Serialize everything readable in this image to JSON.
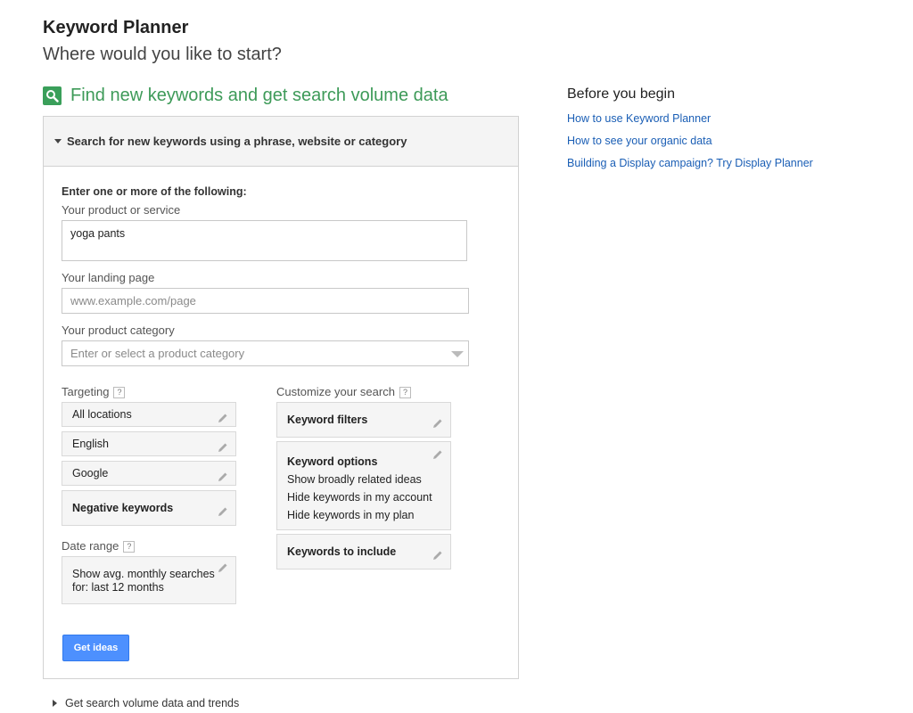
{
  "header": {
    "title": "Keyword Planner",
    "subtitle": "Where would you like to start?"
  },
  "find_section": {
    "title": "Find new keywords and get search volume data",
    "icon": "search-icon",
    "accent_color": "#3d9a58"
  },
  "panel": {
    "header": "Search for new keywords using a phrase, website or category",
    "intro": "Enter one or more of the following:",
    "product_label": "Your product or service",
    "product_value": "yoga pants",
    "landing_label": "Your landing page",
    "landing_placeholder": "www.example.com/page",
    "category_label": "Your product category",
    "category_placeholder": "Enter or select a product category"
  },
  "targeting": {
    "label": "Targeting",
    "help": "?",
    "items": [
      "All locations",
      "English",
      "Google"
    ],
    "negative": "Negative keywords"
  },
  "date_range": {
    "label": "Date range",
    "help": "?",
    "line1": "Show avg. monthly searches",
    "line2": "for: last 12 months"
  },
  "customize": {
    "label": "Customize your search",
    "help": "?",
    "filters": "Keyword filters",
    "options_title": "Keyword options",
    "options_lines": [
      "Show broadly related ideas",
      "Hide keywords in my account",
      "Hide keywords in my plan"
    ],
    "include": "Keywords to include"
  },
  "actions": {
    "get_ideas": "Get ideas",
    "button_color": "#4d90fe"
  },
  "sidebar": {
    "title": "Before you begin",
    "links": [
      "How to use Keyword Planner",
      "How to see your organic data",
      "Building a Display campaign? Try Display Planner"
    ],
    "link_color": "#1a5eb5"
  },
  "bottom": {
    "label": "Get search volume data and trends"
  }
}
